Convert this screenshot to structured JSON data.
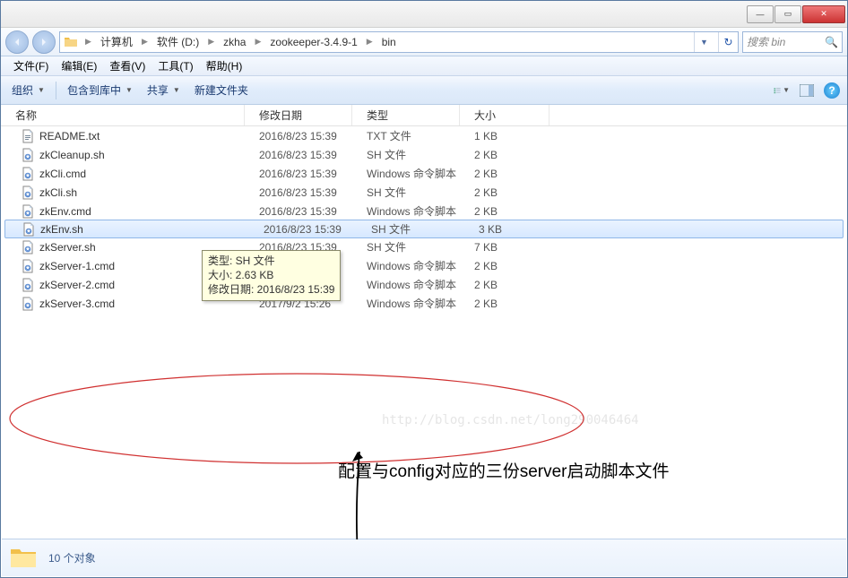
{
  "titlebar": {
    "min": "—",
    "max": "▭",
    "close": "✕"
  },
  "breadcrumbs": [
    "计算机",
    "软件 (D:)",
    "zkha",
    "zookeeper-3.4.9-1",
    "bin"
  ],
  "search": {
    "placeholder": "搜索 bin"
  },
  "menubar": [
    "文件(F)",
    "编辑(E)",
    "查看(V)",
    "工具(T)",
    "帮助(H)"
  ],
  "toolbar": {
    "organize": "组织",
    "include": "包含到库中",
    "share": "共享",
    "newfolder": "新建文件夹"
  },
  "columns": {
    "name": "名称",
    "date": "修改日期",
    "type": "类型",
    "size": "大小"
  },
  "files": [
    {
      "icon": "txt",
      "name": "README.txt",
      "date": "2016/8/23 15:39",
      "type": "TXT 文件",
      "size": "1 KB",
      "sel": false
    },
    {
      "icon": "sh",
      "name": "zkCleanup.sh",
      "date": "2016/8/23 15:39",
      "type": "SH 文件",
      "size": "2 KB",
      "sel": false
    },
    {
      "icon": "cmd",
      "name": "zkCli.cmd",
      "date": "2016/8/23 15:39",
      "type": "Windows 命令脚本",
      "size": "2 KB",
      "sel": false
    },
    {
      "icon": "sh",
      "name": "zkCli.sh",
      "date": "2016/8/23 15:39",
      "type": "SH 文件",
      "size": "2 KB",
      "sel": false
    },
    {
      "icon": "cmd",
      "name": "zkEnv.cmd",
      "date": "2016/8/23 15:39",
      "type": "Windows 命令脚本",
      "size": "2 KB",
      "sel": false
    },
    {
      "icon": "sh",
      "name": "zkEnv.sh",
      "date": "2016/8/23 15:39",
      "type": "SH 文件",
      "size": "3 KB",
      "sel": true
    },
    {
      "icon": "sh",
      "name": "zkServer.sh",
      "date": "2016/8/23 15:39",
      "type": "SH 文件",
      "size": "7 KB",
      "sel": false
    },
    {
      "icon": "cmd",
      "name": "zkServer-1.cmd",
      "date": "",
      "type": "Windows 命令脚本",
      "size": "2 KB",
      "sel": false
    },
    {
      "icon": "cmd",
      "name": "zkServer-2.cmd",
      "date": "",
      "type": "Windows 命令脚本",
      "size": "2 KB",
      "sel": false
    },
    {
      "icon": "cmd",
      "name": "zkServer-3.cmd",
      "date": "2017/9/2 15:26",
      "type": "Windows 命令脚本",
      "size": "2 KB",
      "sel": false
    }
  ],
  "tooltip": {
    "l1": "类型: SH 文件",
    "l2": "大小: 2.63 KB",
    "l3": "修改日期: 2016/8/23 15:39"
  },
  "status": {
    "count": "10 个对象"
  },
  "annotation": "配置与config对应的三份server启动脚本文件",
  "watermark": "http://blog.csdn.net/long290046464"
}
